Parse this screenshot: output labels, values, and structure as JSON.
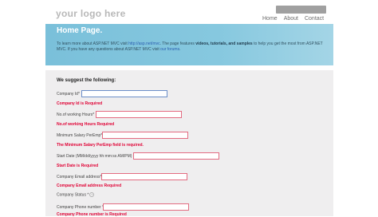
{
  "header": {
    "logo_text": "your logo here",
    "nav": [
      "Home",
      "About",
      "Contact"
    ]
  },
  "featured": {
    "title": "Home Page.",
    "text_1": "To learn more about ASP.NET MVC visit",
    "link": "http://asp.net/mvc",
    "text_2": ". The page features",
    "highlight": "videos, tutorials, and samples",
    "text_3": "to help you get the most from ASP.NET MVC. If you have any questions about ASP.NET MVC visit",
    "forums": "our forums",
    "text_4": "."
  },
  "form": {
    "heading": "We suggest the following:",
    "fields": [
      {
        "label": "Company Id*",
        "error": "Company Id is Required"
      },
      {
        "label": "No.of working Hours*",
        "error": "No.of working Hours Required"
      },
      {
        "label": "Minimum Salary PerEmp*",
        "error": "The Minimum Salary PerEmp field is required."
      },
      {
        "label": "Start Date (MM/dd/yyyy hh:mm:ss AM/PM) *",
        "error": "Start Date is Required"
      },
      {
        "label": "Company Email address*",
        "error": "Company Email address Required"
      },
      {
        "label": "Company Status *",
        "error": ""
      },
      {
        "label": "Company Phone number *",
        "error": "Company Phone number is Required"
      }
    ]
  }
}
